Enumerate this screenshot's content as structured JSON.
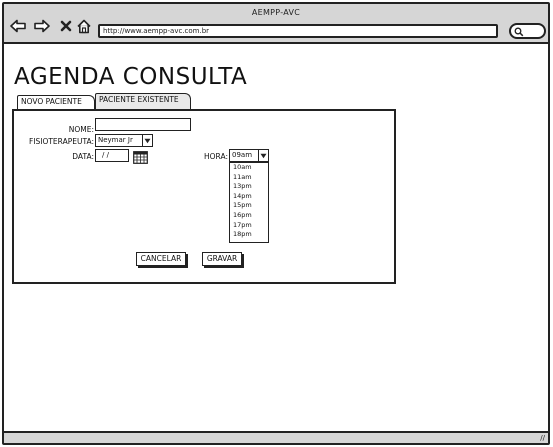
{
  "window": {
    "title": "AEMPP-AVC",
    "address_url": "http://www.aempp-avc.com.br"
  },
  "page": {
    "heading": "AGENDA CONSULTA"
  },
  "tabs": [
    {
      "label": "NOVO PACIENTE",
      "active": true
    },
    {
      "label": "PACIENTE EXISTENTE",
      "active": false
    }
  ],
  "form": {
    "nome_label": "NOME:",
    "nome_value": "",
    "fisio_label": "FISIOTERAPEUTA:",
    "fisio_value": "Neymar Jr",
    "data_label": "DATA:",
    "data_value": "/ /",
    "hora_label": "HORA:",
    "hora_value": "09am",
    "hora_options": [
      "10am",
      "11am",
      "13pm",
      "14pm",
      "15pm",
      "16pm",
      "17pm",
      "18pm"
    ]
  },
  "buttons": {
    "cancel": "CANCELAR",
    "save": "GRAVAR"
  },
  "icons": {
    "back": "back-arrow-icon",
    "forward": "forward-arrow-icon",
    "stop": "close-icon",
    "home": "home-icon",
    "search": "search-icon",
    "calendar": "calendar-icon",
    "dropdown": "chevron-down-icon",
    "resize": "resize-grip-icon"
  },
  "colors": {
    "frame_gray": "#989898",
    "chrome_gray": "#d6d6d6",
    "ink": "#222222"
  }
}
